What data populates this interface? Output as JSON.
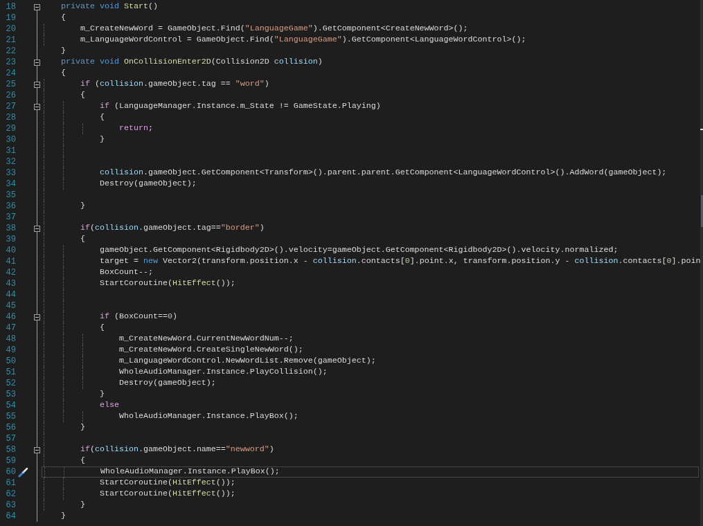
{
  "editor": {
    "lines": [
      {
        "number": "18",
        "expanded": true,
        "current": false,
        "tokens": [
          {
            "kind": "keyword",
            "text": "    private"
          },
          {
            "kind": "keyword",
            "text": " void"
          },
          {
            "kind": "method",
            "text": " Start"
          },
          {
            "kind": "plain",
            "text": "()"
          }
        ]
      },
      {
        "number": "19",
        "current": false,
        "tokens": [
          {
            "kind": "plain",
            "text": "    {"
          }
        ]
      },
      {
        "number": "20",
        "current": false,
        "tokens": [
          {
            "kind": "plain",
            "text": "        m_CreateNewWord = GameObject.Find("
          },
          {
            "kind": "string",
            "text": "\"LanguageGame\""
          },
          {
            "kind": "plain",
            "text": ").GetComponent<CreateNewWord>();"
          }
        ]
      },
      {
        "number": "21",
        "current": false,
        "tokens": [
          {
            "kind": "plain",
            "text": "        m_LanguageWordControl = GameObject.Find("
          },
          {
            "kind": "string",
            "text": "\"LanguageGame\""
          },
          {
            "kind": "plain",
            "text": ").GetComponent<LanguageWordControl>();"
          }
        ]
      },
      {
        "number": "22",
        "current": false,
        "tokens": [
          {
            "kind": "plain",
            "text": "    }"
          }
        ]
      },
      {
        "number": "23",
        "expanded": true,
        "current": false,
        "tokens": [
          {
            "kind": "keyword",
            "text": "    private"
          },
          {
            "kind": "keyword",
            "text": " void"
          },
          {
            "kind": "method",
            "text": " OnCollisionEnter2D"
          },
          {
            "kind": "plain",
            "text": "(Collision2D "
          },
          {
            "kind": "param",
            "text": "collision"
          },
          {
            "kind": "plain",
            "text": ")"
          }
        ]
      },
      {
        "number": "24",
        "current": false,
        "tokens": [
          {
            "kind": "plain",
            "text": "    {"
          }
        ]
      },
      {
        "number": "25",
        "expanded": true,
        "current": false,
        "tokens": [
          {
            "kind": "control",
            "text": "        if"
          },
          {
            "kind": "plain",
            "text": " ("
          },
          {
            "kind": "param",
            "text": "collision"
          },
          {
            "kind": "plain",
            "text": ".gameObject.tag == "
          },
          {
            "kind": "string",
            "text": "\"word\""
          },
          {
            "kind": "plain",
            "text": ")"
          }
        ]
      },
      {
        "number": "26",
        "current": false,
        "tokens": [
          {
            "kind": "plain",
            "text": "        {"
          }
        ]
      },
      {
        "number": "27",
        "expanded": true,
        "current": false,
        "tokens": [
          {
            "kind": "control",
            "text": "            if"
          },
          {
            "kind": "plain",
            "text": " (LanguageManager.Instance.m_State != GameState.Playing)"
          }
        ]
      },
      {
        "number": "28",
        "current": false,
        "tokens": [
          {
            "kind": "plain",
            "text": "            {"
          }
        ]
      },
      {
        "number": "29",
        "current": false,
        "tokens": [
          {
            "kind": "control",
            "text": "                return"
          },
          {
            "kind": "plain",
            "text": ";"
          }
        ]
      },
      {
        "number": "30",
        "current": false,
        "tokens": [
          {
            "kind": "plain",
            "text": "            }"
          }
        ]
      },
      {
        "number": "31",
        "current": false
      },
      {
        "number": "32",
        "current": false
      },
      {
        "number": "33",
        "current": false,
        "tokens": [
          {
            "kind": "param",
            "text": "            collision"
          },
          {
            "kind": "plain",
            "text": ".gameObject.GetComponent<Transform>().parent.parent.GetComponent<LanguageWordControl>().AddWord(gameObject);"
          }
        ]
      },
      {
        "number": "34",
        "current": false,
        "tokens": [
          {
            "kind": "plain",
            "text": "            Destroy(gameObject);"
          }
        ]
      },
      {
        "number": "35",
        "current": false
      },
      {
        "number": "36",
        "current": false,
        "tokens": [
          {
            "kind": "plain",
            "text": "        }"
          }
        ]
      },
      {
        "number": "37",
        "current": false
      },
      {
        "number": "38",
        "expanded": true,
        "current": false,
        "tokens": [
          {
            "kind": "control",
            "text": "        if"
          },
          {
            "kind": "plain",
            "text": "("
          },
          {
            "kind": "param",
            "text": "collision"
          },
          {
            "kind": "plain",
            "text": ".gameObject.tag=="
          },
          {
            "kind": "string",
            "text": "\"border\""
          },
          {
            "kind": "plain",
            "text": ")"
          }
        ]
      },
      {
        "number": "39",
        "current": false,
        "tokens": [
          {
            "kind": "plain",
            "text": "        {"
          }
        ]
      },
      {
        "number": "40",
        "current": false,
        "tokens": [
          {
            "kind": "plain",
            "text": "            gameObject.GetComponent<Rigidbody2D>().velocity=gameObject.GetComponent<Rigidbody2D>().velocity.normalized;"
          }
        ]
      },
      {
        "number": "41",
        "current": false,
        "tokens": [
          {
            "kind": "plain",
            "text": "            target = "
          },
          {
            "kind": "keyword",
            "text": "new"
          },
          {
            "kind": "plain",
            "text": " Vector2(transform.position.x - "
          },
          {
            "kind": "param",
            "text": "collision"
          },
          {
            "kind": "plain",
            "text": ".contacts["
          },
          {
            "kind": "number",
            "text": "0"
          },
          {
            "kind": "plain",
            "text": "].point.x, transform.position.y - "
          },
          {
            "kind": "param",
            "text": "collision"
          },
          {
            "kind": "plain",
            "text": ".contacts["
          },
          {
            "kind": "number",
            "text": "0"
          },
          {
            "kind": "plain",
            "text": "].poin"
          }
        ]
      },
      {
        "number": "42",
        "current": false,
        "tokens": [
          {
            "kind": "plain",
            "text": "            BoxCount--;"
          }
        ]
      },
      {
        "number": "43",
        "current": false,
        "tokens": [
          {
            "kind": "plain",
            "text": "            StartCoroutine("
          },
          {
            "kind": "method",
            "text": "HitEffect"
          },
          {
            "kind": "plain",
            "text": "());"
          }
        ]
      },
      {
        "number": "44",
        "current": false
      },
      {
        "number": "45",
        "current": false
      },
      {
        "number": "46",
        "expanded": true,
        "current": false,
        "tokens": [
          {
            "kind": "control",
            "text": "            if"
          },
          {
            "kind": "plain",
            "text": " (BoxCount=="
          },
          {
            "kind": "number",
            "text": "0"
          },
          {
            "kind": "plain",
            "text": ")"
          }
        ]
      },
      {
        "number": "47",
        "current": false,
        "tokens": [
          {
            "kind": "plain",
            "text": "            {"
          }
        ]
      },
      {
        "number": "48",
        "current": false,
        "tokens": [
          {
            "kind": "plain",
            "text": "                m_CreateNewWord.CurrentNewWordNum--;"
          }
        ]
      },
      {
        "number": "49",
        "current": false,
        "tokens": [
          {
            "kind": "plain",
            "text": "                m_CreateNewWord.CreateSingleNewWord();"
          }
        ]
      },
      {
        "number": "50",
        "current": false,
        "tokens": [
          {
            "kind": "plain",
            "text": "                m_LanguageWordControl.NewWordList.Remove(gameObject);"
          }
        ]
      },
      {
        "number": "51",
        "current": false,
        "tokens": [
          {
            "kind": "plain",
            "text": "                WholeAudioManager.Instance.PlayCollision();"
          }
        ]
      },
      {
        "number": "52",
        "current": false,
        "tokens": [
          {
            "kind": "plain",
            "text": "                Destroy(gameObject);"
          }
        ]
      },
      {
        "number": "53",
        "current": false,
        "tokens": [
          {
            "kind": "plain",
            "text": "            }"
          }
        ]
      },
      {
        "number": "54",
        "current": false,
        "tokens": [
          {
            "kind": "control",
            "text": "            else"
          }
        ]
      },
      {
        "number": "55",
        "current": false,
        "tokens": [
          {
            "kind": "plain",
            "text": "                WholeAudioManager.Instance.PlayBox();"
          }
        ]
      },
      {
        "number": "56",
        "current": false,
        "tokens": [
          {
            "kind": "plain",
            "text": "        }"
          }
        ]
      },
      {
        "number": "57",
        "current": false
      },
      {
        "number": "58",
        "expanded": true,
        "current": false,
        "tokens": [
          {
            "kind": "control",
            "text": "        if"
          },
          {
            "kind": "plain",
            "text": "("
          },
          {
            "kind": "param",
            "text": "collision"
          },
          {
            "kind": "plain",
            "text": ".gameObject.name=="
          },
          {
            "kind": "string",
            "text": "\"newword\""
          },
          {
            "kind": "plain",
            "text": ")"
          }
        ]
      },
      {
        "number": "59",
        "current": false,
        "tokens": [
          {
            "kind": "plain",
            "text": "        {"
          }
        ]
      },
      {
        "number": "60",
        "current": true,
        "quick_action": true,
        "tokens": [
          {
            "kind": "plain",
            "text": "            WholeAudioManager.Instance.PlayBox();"
          }
        ]
      },
      {
        "number": "61",
        "current": false,
        "tokens": [
          {
            "kind": "plain",
            "text": "            StartCoroutine("
          },
          {
            "kind": "method",
            "text": "HitEffect"
          },
          {
            "kind": "plain",
            "text": "());"
          }
        ]
      },
      {
        "number": "62",
        "current": false,
        "tokens": [
          {
            "kind": "plain",
            "text": "            StartCoroutine("
          },
          {
            "kind": "method",
            "text": "HitEffect"
          },
          {
            "kind": "plain",
            "text": "());"
          }
        ]
      },
      {
        "number": "63",
        "current": false,
        "tokens": [
          {
            "kind": "plain",
            "text": "        }"
          }
        ]
      },
      {
        "number": "64",
        "current": false,
        "tokens": [
          {
            "kind": "plain",
            "text": "    }"
          }
        ]
      }
    ]
  }
}
